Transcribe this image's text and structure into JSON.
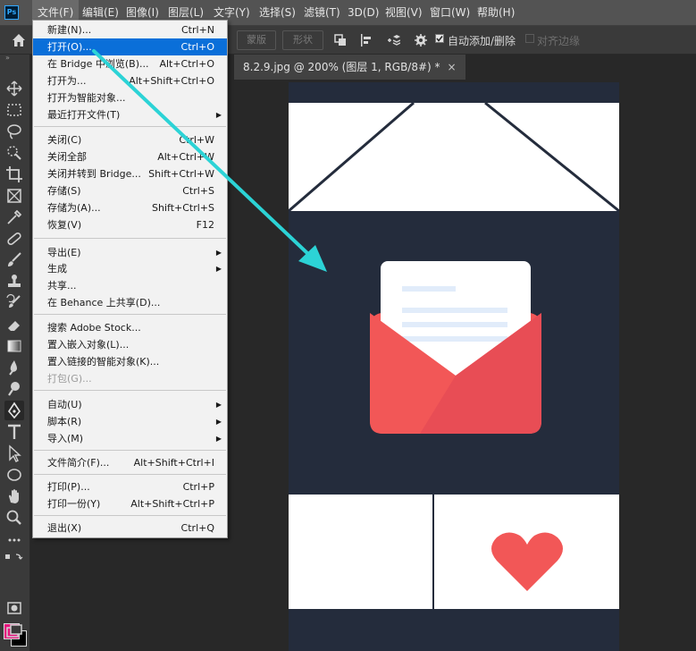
{
  "app": {
    "logo": "Ps"
  },
  "menubar": [
    "文件(F)",
    "编辑(E)",
    "图像(I)",
    "图层(L)",
    "文字(Y)",
    "选择(S)",
    "滤镜(T)",
    "3D(D)",
    "视图(V)",
    "窗口(W)",
    "帮助(H)"
  ],
  "options": {
    "btn_mask": "蒙版",
    "btn_shape": "形状",
    "auto_add_delete": "自动添加/删除",
    "align_edges": "对齐边缘"
  },
  "tab": {
    "title": "8.2.9.jpg @ 200% (图层 1, RGB/8#) *",
    "close": "×"
  },
  "file_menu": {
    "new": {
      "label": "新建(N)...",
      "shortcut": "Ctrl+N"
    },
    "open": {
      "label": "打开(O)...",
      "shortcut": "Ctrl+O"
    },
    "browse_bridge": {
      "label": "在 Bridge 中浏览(B)...",
      "shortcut": "Alt+Ctrl+O"
    },
    "open_as": {
      "label": "打开为...",
      "shortcut": "Alt+Shift+Ctrl+O"
    },
    "open_smart": {
      "label": "打开为智能对象..."
    },
    "recent": {
      "label": "最近打开文件(T)"
    },
    "close": {
      "label": "关闭(C)",
      "shortcut": "Ctrl+W"
    },
    "close_all": {
      "label": "关闭全部",
      "shortcut": "Alt+Ctrl+W"
    },
    "close_bridge": {
      "label": "关闭并转到 Bridge...",
      "shortcut": "Shift+Ctrl+W"
    },
    "save": {
      "label": "存储(S)",
      "shortcut": "Ctrl+S"
    },
    "save_as": {
      "label": "存储为(A)...",
      "shortcut": "Shift+Ctrl+S"
    },
    "revert": {
      "label": "恢复(V)",
      "shortcut": "F12"
    },
    "export": {
      "label": "导出(E)"
    },
    "generate": {
      "label": "生成"
    },
    "share": {
      "label": "共享..."
    },
    "behance": {
      "label": "在 Behance 上共享(D)..."
    },
    "adobe_stock": {
      "label": "搜索 Adobe Stock..."
    },
    "place_embedded": {
      "label": "置入嵌入对象(L)..."
    },
    "place_linked": {
      "label": "置入链接的智能对象(K)..."
    },
    "package": {
      "label": "打包(G)..."
    },
    "automate": {
      "label": "自动(U)"
    },
    "scripts": {
      "label": "脚本(R)"
    },
    "import": {
      "label": "导入(M)"
    },
    "file_info": {
      "label": "文件简介(F)...",
      "shortcut": "Alt+Shift+Ctrl+I"
    },
    "print": {
      "label": "打印(P)...",
      "shortcut": "Ctrl+P"
    },
    "print_one": {
      "label": "打印一份(Y)",
      "shortcut": "Alt+Shift+Ctrl+P"
    },
    "exit": {
      "label": "退出(X)",
      "shortcut": "Ctrl+Q"
    }
  },
  "colors": {
    "foreground": "#e5137d",
    "background": "#000000",
    "envelope_red": "#f25757",
    "canvas_navy": "#242c3c",
    "annotation_arrow": "#2cd3d6"
  }
}
